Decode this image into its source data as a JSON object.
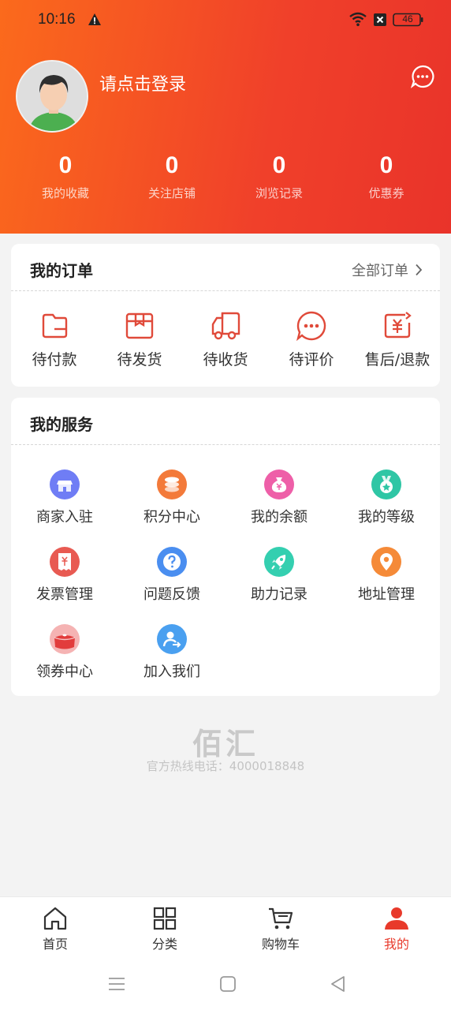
{
  "status": {
    "time": "10:16",
    "battery": "46"
  },
  "profile": {
    "login_prompt": "请点击登录"
  },
  "stats": [
    {
      "value": "0",
      "label": "我的收藏"
    },
    {
      "value": "0",
      "label": "关注店铺"
    },
    {
      "value": "0",
      "label": "浏览记录"
    },
    {
      "value": "0",
      "label": "优惠券"
    }
  ],
  "orders": {
    "title": "我的订单",
    "all_label": "全部订单",
    "items": [
      {
        "label": "待付款",
        "icon": "wallet-icon"
      },
      {
        "label": "待发货",
        "icon": "package-icon"
      },
      {
        "label": "待收货",
        "icon": "truck-icon"
      },
      {
        "label": "待评价",
        "icon": "comment-icon"
      },
      {
        "label": "售后/退款",
        "icon": "refund-icon"
      }
    ]
  },
  "services": {
    "title": "我的服务",
    "items": [
      {
        "label": "商家入驻",
        "icon": "store-icon",
        "color": "#6f7df5"
      },
      {
        "label": "积分中心",
        "icon": "coins-icon",
        "color": "#f37a3a"
      },
      {
        "label": "我的余额",
        "icon": "money-bag-icon",
        "color": "#ee5fa8"
      },
      {
        "label": "我的等级",
        "icon": "medal-icon",
        "color": "#2fc6a5"
      },
      {
        "label": "发票管理",
        "icon": "invoice-icon",
        "color": "#e85a52"
      },
      {
        "label": "问题反馈",
        "icon": "question-icon",
        "color": "#4a8ef0"
      },
      {
        "label": "助力记录",
        "icon": "rocket-icon",
        "color": "#34cfb0"
      },
      {
        "label": "地址管理",
        "icon": "location-icon",
        "color": "#f58a38"
      },
      {
        "label": "领券中心",
        "icon": "coupon-icon",
        "color": "#f06a6a"
      },
      {
        "label": "加入我们",
        "icon": "join-user-icon",
        "color": "#4aa0f0"
      }
    ]
  },
  "footer": {
    "brand": "佰汇",
    "hotline": "官方热线电话：4000018848"
  },
  "tabbar": {
    "items": [
      {
        "label": "首页",
        "icon": "home-icon"
      },
      {
        "label": "分类",
        "icon": "grid-icon"
      },
      {
        "label": "购物车",
        "icon": "cart-icon"
      },
      {
        "label": "我的",
        "icon": "user-icon",
        "active": true
      }
    ]
  },
  "colors": {
    "accent": "#e83a2b",
    "header_start": "#fb6a1c",
    "header_end": "#e9332a"
  }
}
